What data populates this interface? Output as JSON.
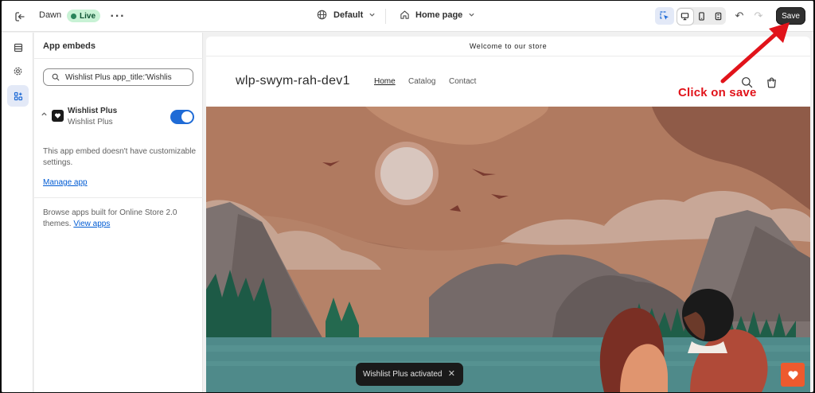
{
  "topbar": {
    "theme_name": "Dawn",
    "live_label": "Live",
    "env_label": "Default",
    "page_label": "Home page",
    "save_label": "Save"
  },
  "sidebar": {
    "title": "App embeds",
    "search_value": "Wishlist Plus app_title:'Wishlis",
    "embed": {
      "name": "Wishlist Plus",
      "source": "Wishlist Plus",
      "enabled": true
    },
    "note": "This app embed doesn't have customizable settings.",
    "manage_link": "Manage app",
    "browse_text": "Browse apps built for Online Store 2.0 themes.",
    "view_apps_link": "View apps"
  },
  "preview": {
    "announcement": "Welcome to our store",
    "store_name": "wlp-swym-rah-dev1",
    "nav": [
      "Home",
      "Catalog",
      "Contact"
    ]
  },
  "toast": {
    "message": "Wishlist Plus activated",
    "close_glyph": "✕"
  },
  "annotation": {
    "text": "Click on save"
  },
  "colors": {
    "accent_blue": "#1f6bd6",
    "live_green": "#29845a",
    "annotation_red": "#e1131a",
    "wishlist_orange": "#ee5a2e"
  },
  "icons": {
    "exit": "exit-icon",
    "more": "more-horizontal-icon",
    "globe": "globe-icon",
    "home": "home-icon",
    "inspect": "inspector-icon",
    "desktop": "desktop-icon",
    "mobile": "mobile-icon",
    "fullscreen": "fullscreen-icon",
    "undo": "undo-icon",
    "redo": "redo-icon",
    "sections": "sections-icon",
    "settings": "gear-icon",
    "app_embeds": "app-embeds-icon",
    "search": "search-icon",
    "cart": "cart-icon",
    "heart": "heart-icon"
  }
}
